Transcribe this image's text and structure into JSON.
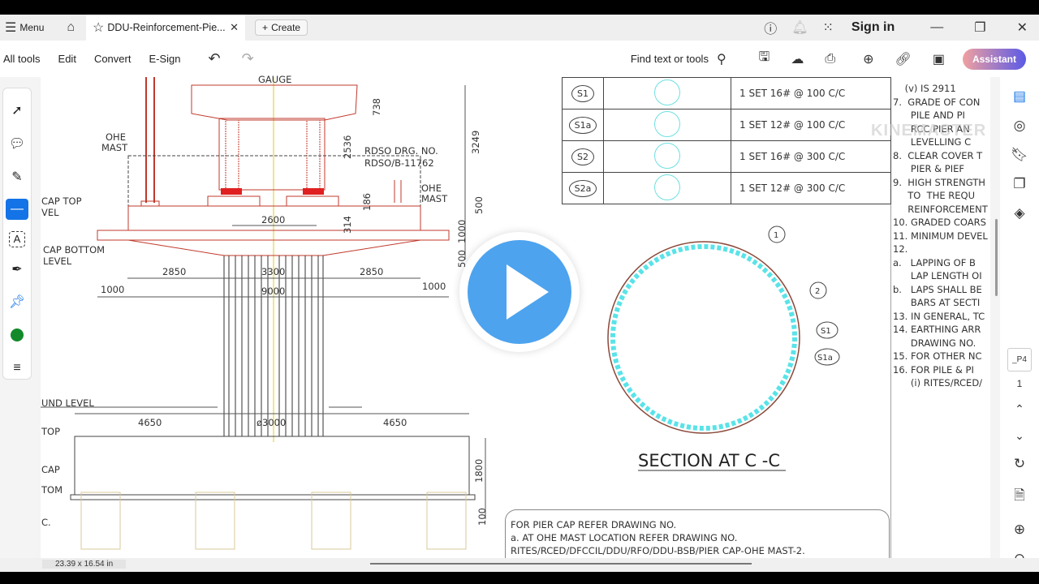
{
  "tabbar": {
    "menu": "Menu",
    "tab_title": "DDU-Reinforcement-Pie...",
    "create": "Create",
    "sign_in": "Sign in"
  },
  "toolbar": {
    "all_tools": "All tools",
    "edit": "Edit",
    "convert": "Convert",
    "esign": "E-Sign",
    "find": "Find text or tools",
    "assistant": "Assistant"
  },
  "drawing": {
    "labels": {
      "gauge": "GAUGE",
      "ohe_mast_l1": "OHE",
      "ohe_mast_l2": "MAST",
      "ohe_mast_r1": "OHE",
      "ohe_mast_r2": "MAST",
      "rdso1": "RDSO DRG. NO.",
      "rdso2": "RDSO/B-11762",
      "cap_top1": "CAP TOP",
      "cap_top2": "VEL",
      "cap_bottom1": "CAP BOTTOM",
      "cap_bottom2": "LEVEL",
      "ground": "UND LEVEL",
      "top": "TOP",
      "cap": "CAP",
      "tom": "TOM",
      "c": "C."
    },
    "dims": {
      "d738": "738",
      "d3249": "3249",
      "d2536": "2536",
      "d186": "186",
      "d314": "314",
      "d500a": "500",
      "d1000v": "1000",
      "d500b": "500",
      "d2600": "2600",
      "d2850a": "2850",
      "d3300": "3300",
      "d2850b": "2850",
      "d1000a": "1000",
      "d9000": "9000",
      "d1000b": "1000",
      "d4650a": "4650",
      "d3000": "ø3000",
      "d4650b": "4650",
      "d1800": "1800",
      "d100": "100"
    },
    "section_title": "SECTION AT C -C",
    "callouts": [
      "1",
      "2",
      "S1",
      "S1a"
    ]
  },
  "schedule": [
    {
      "mark": "S1",
      "spec": "1 SET 16# @ 100 C/C"
    },
    {
      "mark": "S1a",
      "spec": "1 SET 12# @ 100 C/C"
    },
    {
      "mark": "S2",
      "spec": "1 SET 16# @ 300 C/C"
    },
    {
      "mark": "S2a",
      "spec": "1 SET 12# @ 300 C/C"
    }
  ],
  "notes": [
    "    (v) IS 2911",
    "7.  GRADE OF CON",
    "      PILE AND PI",
    "      RCC PIER AN",
    "      LEVELLING C",
    "8.  CLEAR COVER T",
    "      PIER & PIEF",
    "9.  HIGH STRENGTH",
    "     TO  THE REQU",
    "     REINFORCEMENT",
    "10. GRADED COARS",
    "11. MINIMUM DEVEL",
    "12.",
    "a.   LAPPING OF B",
    "      LAP LENGTH OI",
    "b.   LAPS SHALL BE",
    "      BARS AT SECTI",
    "13. IN GENERAL, TC",
    "14. EARTHING ARR",
    "      DRAWING NO.",
    "15. FOR OTHER NC",
    "16. FOR PILE & PI",
    "      (i) RITES/RCED/"
  ],
  "cloud_note": [
    "FOR PIER CAP REFER DRAWING NO.",
    "a.   AT OHE MAST LOCATION REFER DRAWING NO.",
    "      RITES/RCED/DFCCIL/DDU/RFO/DDU-BSB/PIER CAP-OHE MAST-2."
  ],
  "page": {
    "label": "_P4",
    "number": "1"
  },
  "status": {
    "page_size": "23.39 x 16.54 in"
  },
  "watermark": "KINEMASTER",
  "colors": {
    "accent": "#1473e6",
    "play": "#4da3ee",
    "rebar": "#59e3e8",
    "structure": "#c0392b"
  }
}
